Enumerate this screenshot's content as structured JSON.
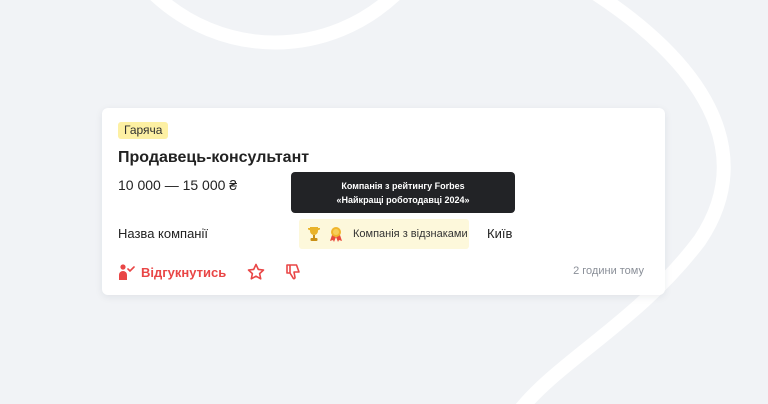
{
  "vacancy": {
    "badge": "Гаряча",
    "title": "Продавець-консультант",
    "salary": "10 000 — 15 000 ₴",
    "company": "Назва компанії",
    "awards_label": "Компанія з відзнаками",
    "city": "Київ",
    "apply_label": "Відгукнутись",
    "posted": "2 години тому"
  },
  "tooltip": {
    "line1": "Компанія з рейтингу Forbes",
    "line2": "«Найкращі роботодавці 2024»"
  },
  "icons": {
    "trophy": "trophy-icon",
    "medal": "medal-icon",
    "apply": "apply-person-icon",
    "star": "star-icon",
    "dislike": "thumbs-down-icon"
  },
  "colors": {
    "background": "#f1f3f6",
    "accent_red": "#e94646",
    "badge_yellow": "#fdf0a3",
    "awards_bg": "#fdf8db",
    "tooltip_bg": "#222326"
  }
}
